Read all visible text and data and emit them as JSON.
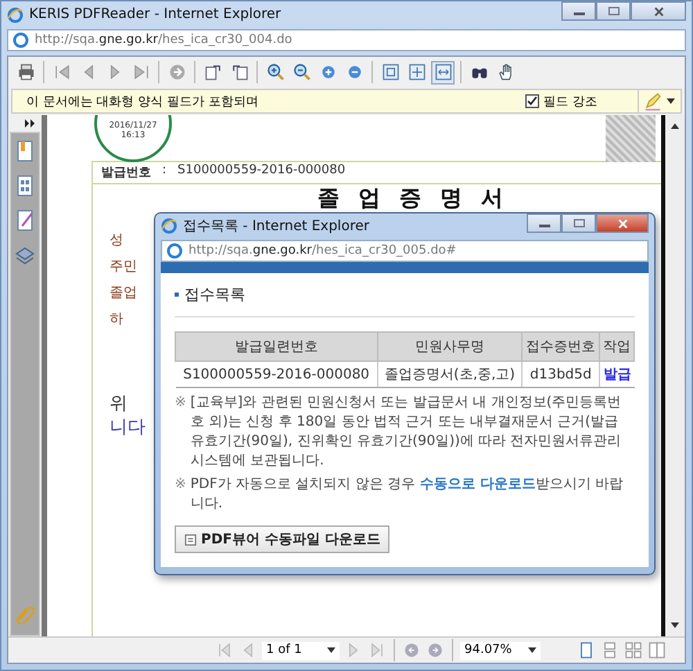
{
  "window": {
    "title": "KERIS PDFReader - Internet Explorer",
    "url_host": "http://sqa.",
    "url_domain": "gne.go.kr",
    "url_path": "/hes_ica_cr30_004.do"
  },
  "form_bar": {
    "message": "이 문서에는 대화형 양식 필드가 포함되며",
    "highlight_label": "필드 강조",
    "highlight_checked": true
  },
  "document": {
    "stamp_date": "2016/11/27",
    "stamp_time": "16:13",
    "issue_label": "발급번호",
    "issue_sep": ":",
    "issue_number": "S100000559-2016-000080",
    "title": "졸 업 증 명 서",
    "labels": [
      {
        "text": "성"
      },
      {
        "text": "주민"
      },
      {
        "text": "졸업"
      },
      {
        "text": "하"
      }
    ],
    "lower_labels": [
      {
        "text": "위"
      },
      {
        "text": "니다"
      }
    ]
  },
  "popup": {
    "title": "접수목록 - Internet Explorer",
    "url_host": "http://sqa.",
    "url_domain": "gne.go.kr",
    "url_path": "/hes_ica_cr30_005.do#",
    "heading": "접수목록",
    "table": {
      "columns": [
        "발급일련번호",
        "민원사무명",
        "접수증번호",
        "작업"
      ],
      "rows": [
        {
          "cells": [
            "S100000559-2016-000080",
            "졸업증명서(초,중,고)",
            "d13bd5d"
          ],
          "action": "발급"
        }
      ]
    },
    "note_mark": "※",
    "note1": "[교육부]와 관련된 민원신청서 또는 발급문서 내 개인정보(주민등록번호 외)는 신청 후 180일 동안 법적 근거 또는 내부결재문서 근거(발급 유효기간(90일), 진위확인 유효기간(90일))에 따라 전자민원서류관리시스템에 보관됩니다.",
    "note2_before": "PDF가 자동으로 설치되지 않은 경우 ",
    "note2_link": "수동으로 다운로드",
    "note2_after": "받으시기 바랍니다.",
    "download_button": "PDF뷰어 수동파일 다운로드"
  },
  "status_bar": {
    "page": "1 of 1",
    "zoom": "94.07%"
  }
}
